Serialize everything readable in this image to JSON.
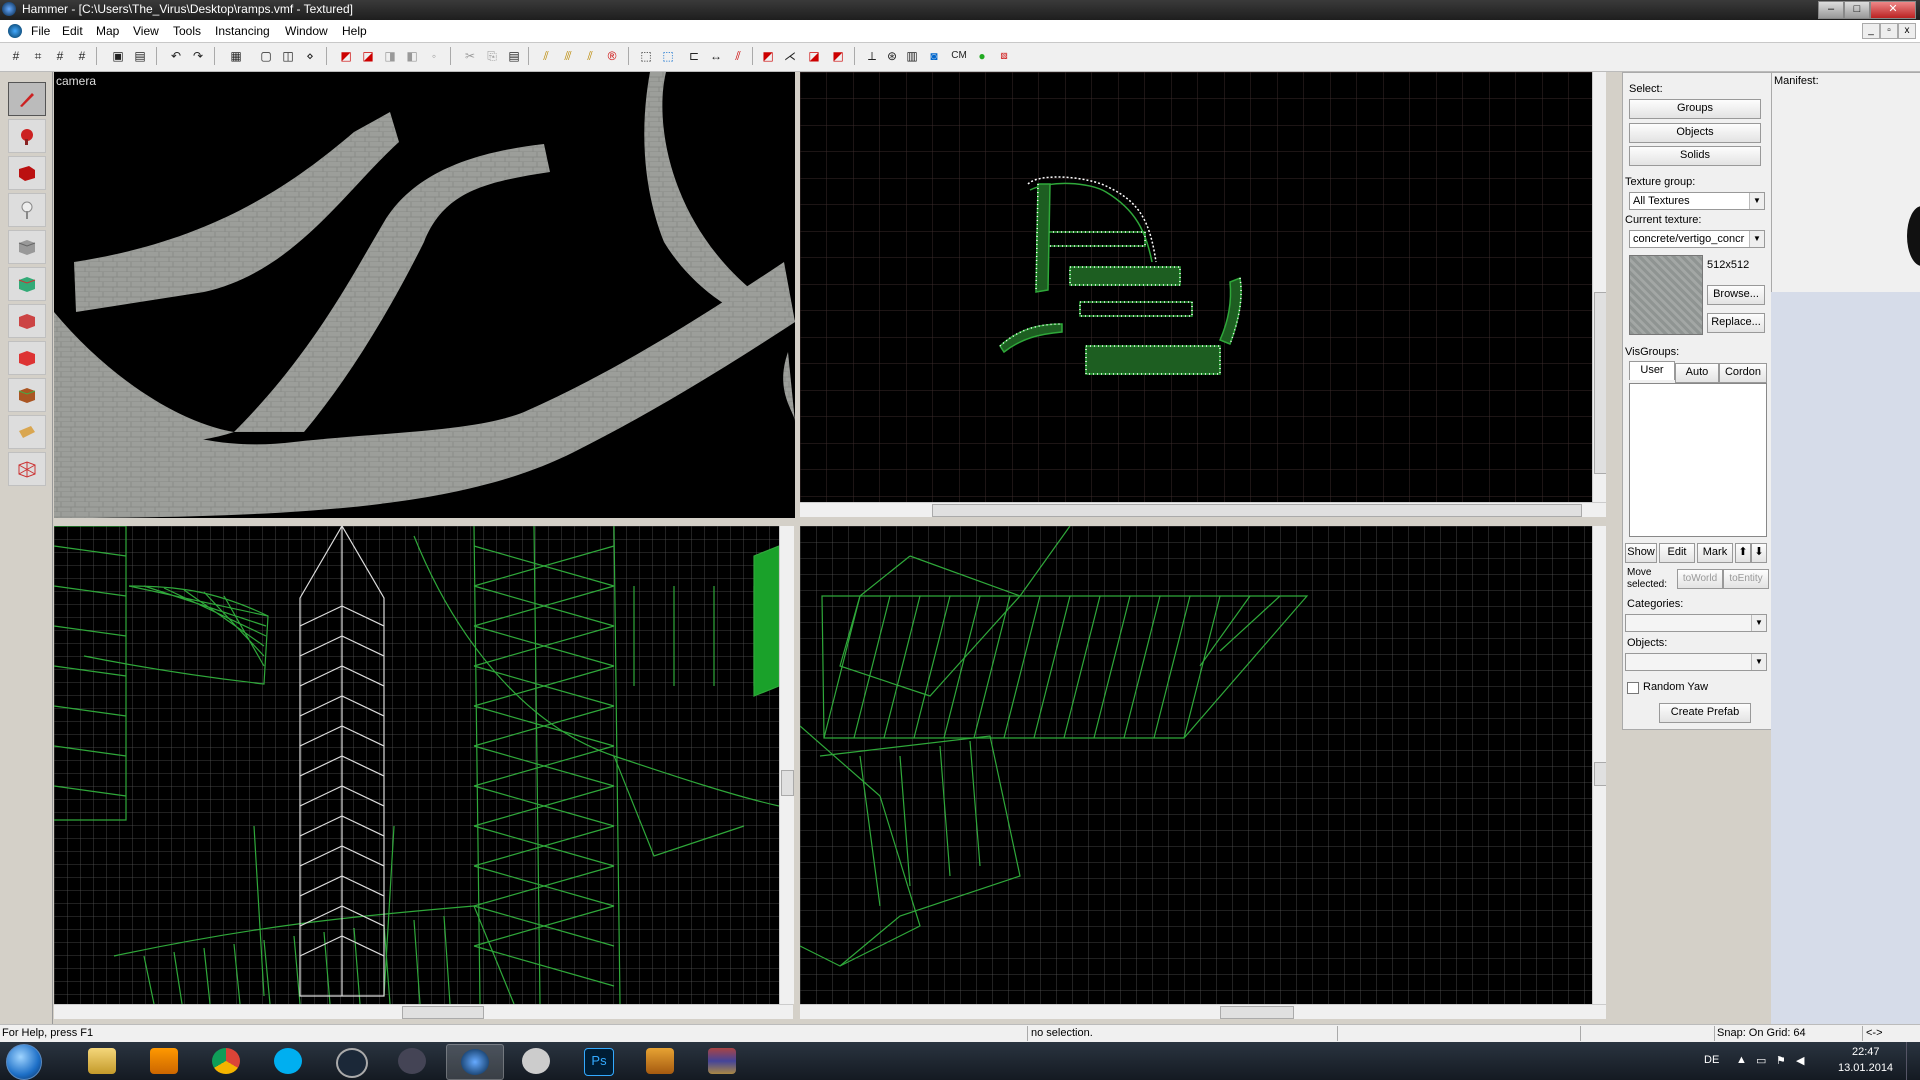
{
  "window": {
    "title": "Hammer - [C:\\Users\\The_Virus\\Desktop\\ramps.vmf - Textured]",
    "min": "–",
    "max": "□",
    "close": "✕"
  },
  "menu": {
    "items": [
      "File",
      "Edit",
      "Map",
      "View",
      "Tools",
      "Instancing",
      "Window",
      "Help"
    ]
  },
  "toolbar": {
    "cm_label": "CM",
    "icons": [
      "grid-icon",
      "grid-toggle-icon",
      "grid-smaller-icon",
      "grid-larger-icon",
      "group-icon",
      "ungroup-icon",
      "undo-icon",
      "redo-icon",
      "carve-icon",
      "hollow-icon",
      "clip-icon",
      "vertex-icon",
      "texture-lock-icon",
      "cut-icon",
      "copy-icon",
      "paste-icon",
      "texture-app-icon",
      "toggle-helpers-icon",
      "toggle-models-icon",
      "toggle-lighting-icon",
      "selection-icon",
      "select-by-handles-icon",
      "decal-icon",
      "overlay-icon",
      "flip-icon",
      "compile-icon",
      "run-icon",
      "check-icon",
      "entity-report-icon",
      "cordon-icon",
      "3d-grid-icon",
      "load-window-icon",
      "map-info-icon",
      "cubemap-icon",
      "draw-icon"
    ]
  },
  "viewports": {
    "camera": {
      "label": "camera"
    }
  },
  "select_panel": {
    "select_label": "Select:",
    "groups": "Groups",
    "objects": "Objects",
    "solids": "Solids",
    "texture_group_label": "Texture group:",
    "texture_group_value": "All Textures",
    "current_texture_label": "Current texture:",
    "current_texture_value": "concrete/vertigo_concr",
    "texture_size": "512x512",
    "browse": "Browse...",
    "replace": "Replace...",
    "visgroups_label": "VisGroups:",
    "tabs": [
      "User",
      "Auto",
      "Cordon"
    ],
    "show": "Show",
    "edit": "Edit",
    "mark": "Mark",
    "up": "⬆",
    "down": "⬇",
    "move_selected": "Move selected:",
    "to_world": "toWorld",
    "to_entity": "toEntity",
    "categories_label": "Categories:",
    "objects_label": "Objects:",
    "random_yaw": "Random Yaw",
    "create_prefab": "Create Prefab"
  },
  "manifest": {
    "label": "Manifest:"
  },
  "statusbar": {
    "help": "For Help, press F1",
    "selection": "no selection.",
    "snap": "Snap: On Grid: 64",
    "arrows": "<->"
  },
  "taskbar": {
    "apps": [
      "explorer-icon",
      "media-player-icon",
      "chrome-icon",
      "skype-icon",
      "steam-icon",
      "teamspeak-icon",
      "hammer-icon",
      "paint-icon",
      "photoshop-icon",
      "csgo-icon",
      "winrar-icon"
    ],
    "active": "hammer-icon",
    "lang": "DE",
    "time": "22:47",
    "date": "13.01.2014"
  },
  "colors": {
    "grid_major": "#3a2a2a",
    "grid_minor": "#2a2a2a",
    "wire": "#2fa83a",
    "vertex": "#ffffff",
    "floor": "#9a9c98"
  }
}
